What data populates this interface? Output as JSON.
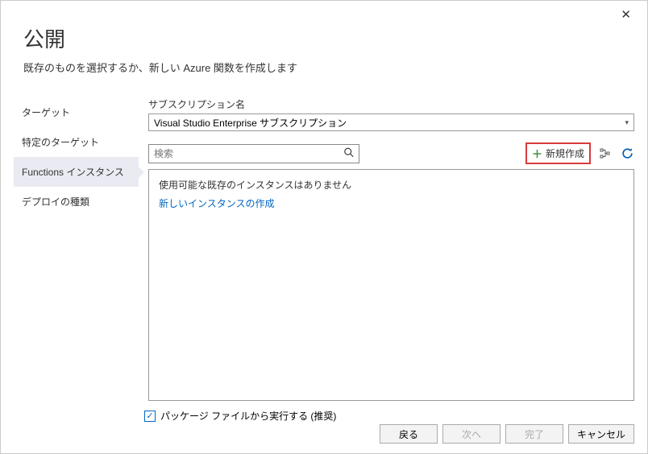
{
  "header": {
    "title": "公開",
    "subtitle": "既存のものを選択するか、新しい Azure 関数を作成します"
  },
  "sidebar": {
    "items": [
      {
        "label": "ターゲット"
      },
      {
        "label": "特定のターゲット"
      },
      {
        "label": "Functions インスタンス",
        "active": true
      },
      {
        "label": "デプロイの種類"
      }
    ]
  },
  "subscription": {
    "label": "サブスクリプション名",
    "value": "Visual Studio Enterprise サブスクリプション"
  },
  "search": {
    "placeholder": "検索"
  },
  "actions": {
    "new_label": "新規作成"
  },
  "list": {
    "empty_message": "使用可能な既存のインスタンスはありません",
    "create_link": "新しいインスタンスの作成"
  },
  "checkbox": {
    "label": "パッケージ ファイルから実行する (推奨)",
    "checked": true
  },
  "footer": {
    "back": "戻る",
    "next": "次へ",
    "finish": "完了",
    "cancel": "キャンセル"
  }
}
